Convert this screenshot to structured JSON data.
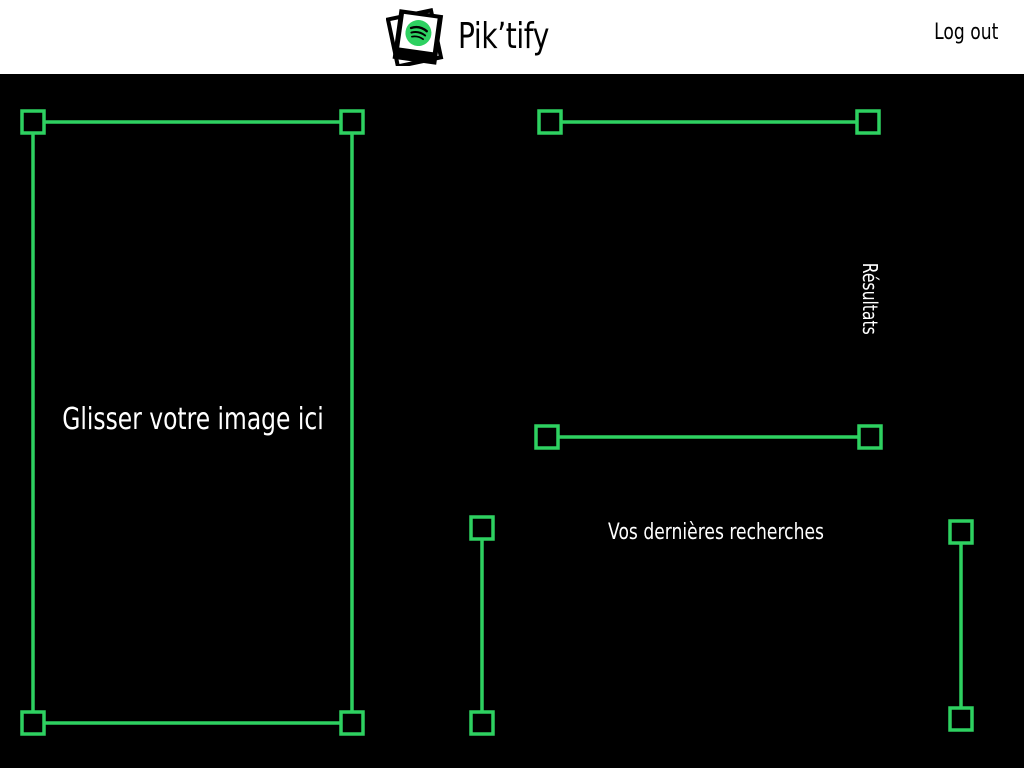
{
  "header": {
    "brand_name": "Pik’tify",
    "logout_label": "Log out"
  },
  "upload": {
    "drop_label": "Glisser votre image ici"
  },
  "results": {
    "label": "Résultats"
  },
  "history": {
    "label": "Vos dernières recherches"
  },
  "colors": {
    "accent": "#2ed161",
    "background": "#000000",
    "header_background": "#ffffff",
    "text_on_dark": "#ffffff"
  },
  "icons": {
    "logo": "polaroid-spotify-icon",
    "corner": "square-handle-icon"
  }
}
